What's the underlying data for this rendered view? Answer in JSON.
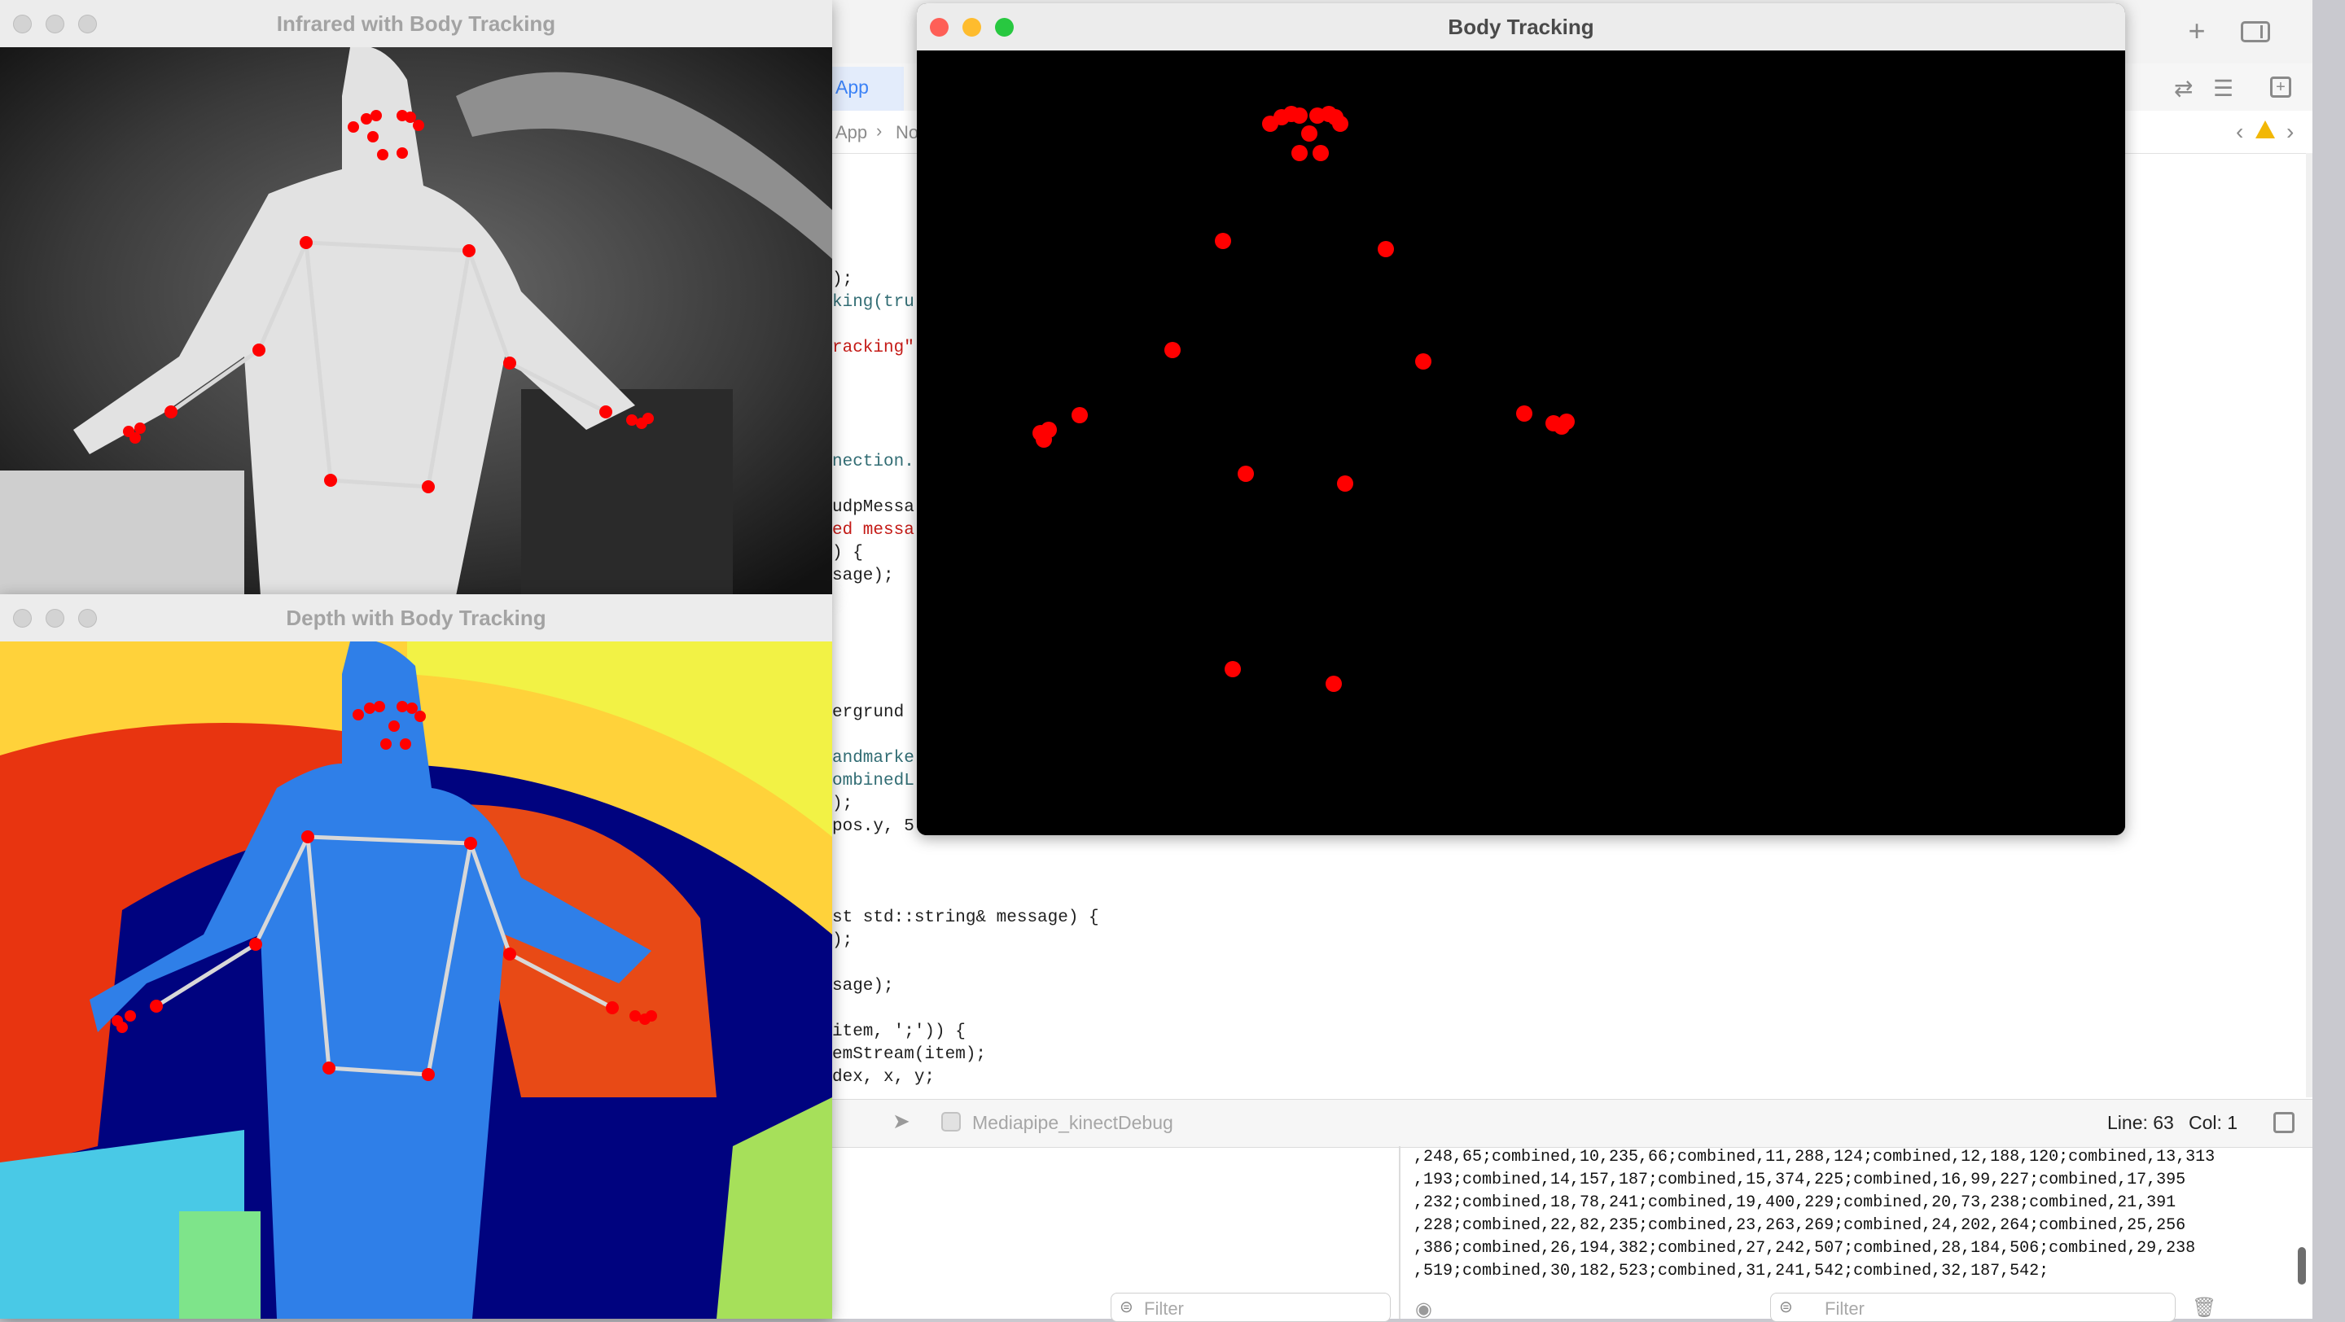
{
  "windows": {
    "infrared": {
      "title": "Infrared with Body Tracking"
    },
    "depth": {
      "title": "Depth with Body Tracking"
    },
    "body": {
      "title": "Body Tracking"
    }
  },
  "xcode": {
    "tab_label": "App",
    "breadcrumb": [
      "App",
      "No"
    ],
    "code_lines": [
      ");",
      "king(tru",
      "racking\"",
      "nection.",
      "udpMessa",
      "ed messa",
      ") {",
      "sage);",
      "ergrund",
      "andmarke",
      "ombinedL",
      ");",
      "pos.y, 5",
      "st std::string& message) {",
      ");",
      "sage);",
      "item, ';')) {",
      "emStream(item);",
      "dex, x, y;"
    ],
    "scheme_name": "Mediapipe_kinectDebug",
    "status": {
      "line": "Line: 63",
      "col": "Col: 1"
    },
    "filter_placeholder": "Filter",
    "console_lines": [
      ",248,65;combined,10,235,66;combined,11,288,124;combined,12,188,120;combined,13,313",
      ",193;combined,14,157,187;combined,15,374,225;combined,16,99,227;combined,17,395",
      ",232;combined,18,78,241;combined,19,400,229;combined,20,73,238;combined,21,391",
      ",228;combined,22,82,235;combined,23,263,269;combined,24,202,264;combined,25,256",
      ",386;combined,26,194,382;combined,27,242,507;combined,28,184,506;combined,29,238",
      ",519;combined,30,182,523;combined,31,241,542;combined,32,187,542;"
    ]
  },
  "icons": [
    "plus-icon",
    "sidebar-toggle-icon",
    "swap-icon",
    "inspector-icon",
    "add-editor-icon",
    "warning-icon",
    "chevron-left-icon",
    "chevron-right-icon",
    "location-icon",
    "eye-icon",
    "trash-icon",
    "filter-icon"
  ],
  "colors": {
    "landmark": "#ff0000",
    "skeleton": "#d8d8d8",
    "depth_body": "#2f7fe8",
    "close": "#fe5f57",
    "minimize": "#febc2e",
    "zoom": "#28c840"
  }
}
